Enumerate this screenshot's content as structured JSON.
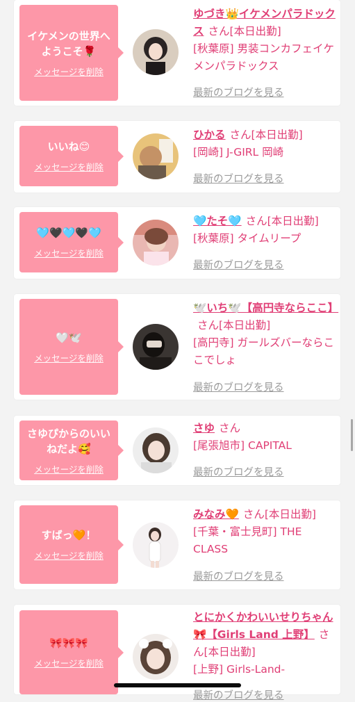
{
  "delete_label": "メッセージを削除",
  "blog_label": "最新のブログを見る",
  "san_label": "さん",
  "colors": {
    "bubble": "#fd97a8",
    "accent": "#e03e75",
    "muted": "#9a9a9a",
    "page_background": "#f3f3f3"
  },
  "messages": [
    {
      "message": "イケメンの世界へようこそ🌹",
      "name": "ゆづき👑イケメンパラドックス",
      "work_status": "[本日出勤]",
      "shop": "[秋葉原] 男装コンカフェイケメンパラドックス"
    },
    {
      "message": "いいね😊",
      "name": "ひかる",
      "work_status": "[本日出勤]",
      "shop": "[岡崎] J-GIRL 岡崎"
    },
    {
      "message": "🩵🖤🩵🖤🩵",
      "name": "🩵たそ🩵",
      "work_status": "[本日出勤]",
      "shop": "[秋葉原] タイムリープ"
    },
    {
      "message": "🤍🕊️",
      "name": "🕊️いち🕊️【高円寺ならここ】",
      "work_status": "[本日出勤]",
      "shop": "[高円寺] ガールズバーならここでしょ"
    },
    {
      "message": "さゆぴからのいいねだよ🥰",
      "name": "さゆ",
      "work_status": "",
      "shop": "[尾張旭市] CAPITAL"
    },
    {
      "message": "すばっ🧡！",
      "name": "みなみ🧡",
      "work_status": "[本日出勤]",
      "shop": "[千葉・富士見町] THE CLASS"
    },
    {
      "message": "🎀🎀🎀",
      "name": "とにかくかわいいせりちゃん🎀【Girls Land 上野】",
      "work_status": "[本日出勤]",
      "shop": "[上野] Girls-Land-"
    }
  ]
}
